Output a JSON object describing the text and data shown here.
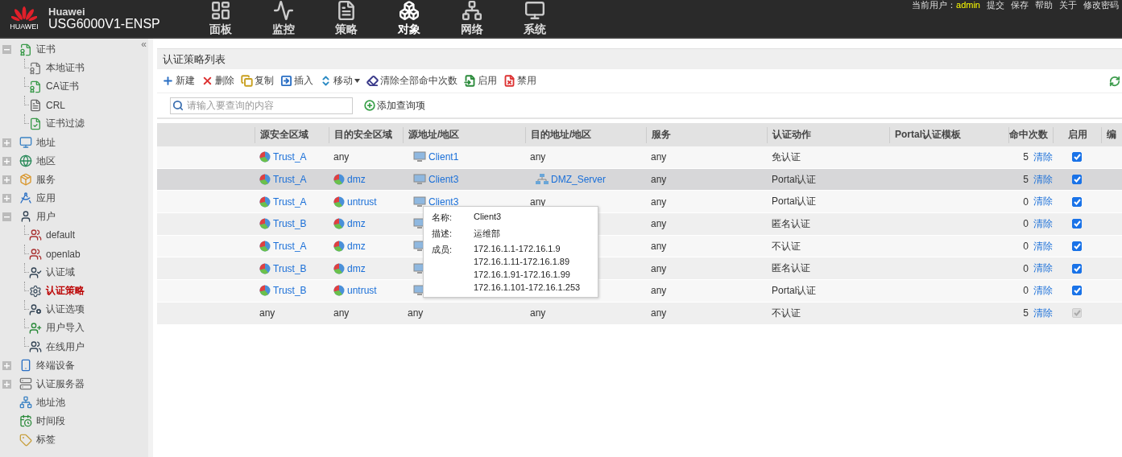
{
  "header": {
    "logo_text": "HUAWEI",
    "brand": "Huawei",
    "product": "USG6000V1-ENSP",
    "nav": [
      {
        "label": "面板",
        "selected": false
      },
      {
        "label": "监控",
        "selected": false
      },
      {
        "label": "策略",
        "selected": false
      },
      {
        "label": "对象",
        "selected": true
      },
      {
        "label": "网络",
        "selected": false
      },
      {
        "label": "系统",
        "selected": false
      }
    ],
    "user_label": "当前用户：",
    "user_name": "admin",
    "links": [
      "提交",
      "保存",
      "帮助",
      "关于",
      "修改密码"
    ]
  },
  "sidebar": {
    "collapse": "«",
    "items": [
      {
        "label": "证书",
        "expanded": true,
        "selected": false,
        "children": [
          {
            "label": "本地证书",
            "selected": false
          },
          {
            "label": "CA证书",
            "selected": false
          },
          {
            "label": "CRL",
            "selected": false
          },
          {
            "label": "证书过滤",
            "selected": false
          }
        ]
      },
      {
        "label": "地址",
        "expanded": false,
        "selected": false
      },
      {
        "label": "地区",
        "expanded": false,
        "selected": false
      },
      {
        "label": "服务",
        "expanded": false,
        "selected": false
      },
      {
        "label": "应用",
        "expanded": false,
        "selected": false
      },
      {
        "label": "用户",
        "expanded": true,
        "selected": false,
        "children": [
          {
            "label": "default",
            "selected": false
          },
          {
            "label": "openlab",
            "selected": false
          },
          {
            "label": "认证域",
            "selected": false
          },
          {
            "label": "认证策略",
            "selected": true
          },
          {
            "label": "认证选项",
            "selected": false
          },
          {
            "label": "用户导入",
            "selected": false
          },
          {
            "label": "在线用户",
            "selected": false
          }
        ]
      },
      {
        "label": "终端设备",
        "expanded": false,
        "selected": false
      },
      {
        "label": "认证服务器",
        "expanded": false,
        "selected": false
      },
      {
        "label": "地址池",
        "selected": false
      },
      {
        "label": "时间段",
        "selected": false
      },
      {
        "label": "标签",
        "selected": false
      }
    ]
  },
  "panel": {
    "title": "认证策略列表",
    "toolbar": [
      {
        "label": "新建",
        "has_menu": false
      },
      {
        "label": "删除",
        "has_menu": false
      },
      {
        "label": "复制",
        "has_menu": false
      },
      {
        "label": "插入",
        "has_menu": false
      },
      {
        "label": "移动",
        "has_menu": true
      },
      {
        "label": "清除全部命中次数",
        "has_menu": false
      },
      {
        "label": "启用",
        "has_menu": false
      },
      {
        "label": "禁用",
        "has_menu": false
      }
    ],
    "search": {
      "placeholder": "请输入要查询的内容"
    },
    "add_query": "添加查询项",
    "table": {
      "columns": [
        "源安全区域",
        "目的安全区域",
        "源地址/地区",
        "目的地址/地区",
        "服务",
        "认证动作",
        "Portal认证模板",
        "命中次数",
        "启用",
        "编"
      ],
      "rows": [
        {
          "selected": false,
          "src_zone": {
            "kind": "zone",
            "text": "Trust_A"
          },
          "dst_zone": {
            "kind": "plain",
            "text": "any"
          },
          "src_addr": {
            "kind": "address",
            "text": "Client1"
          },
          "dst_addr": {
            "kind": "plain",
            "text": "any"
          },
          "service": "any",
          "action": "免认证",
          "hits": "5",
          "clear": "清除",
          "checked": true,
          "disabled": false
        },
        {
          "selected": true,
          "src_zone": {
            "kind": "zone",
            "text": "Trust_A"
          },
          "dst_zone": {
            "kind": "zone",
            "text": "dmz"
          },
          "src_addr": {
            "kind": "address",
            "text": "Client3"
          },
          "dst_addr": {
            "kind": "server",
            "text": "DMZ_Server"
          },
          "service": "any",
          "action": "Portal认证",
          "hits": "5",
          "clear": "清除",
          "checked": true,
          "disabled": false
        },
        {
          "selected": false,
          "src_zone": {
            "kind": "zone",
            "text": "Trust_A"
          },
          "dst_zone": {
            "kind": "zone",
            "text": "untrust"
          },
          "src_addr": {
            "kind": "address",
            "text": "Client3"
          },
          "dst_addr": {
            "kind": "plain",
            "text": "any"
          },
          "service": "any",
          "action": "Portal认证",
          "hits": "0",
          "clear": "清除",
          "checked": true,
          "disabled": false
        },
        {
          "selected": false,
          "src_zone": {
            "kind": "zone",
            "text": "Trust_B"
          },
          "dst_zone": {
            "kind": "zone",
            "text": "dmz"
          },
          "src_addr": {
            "kind": "address"
          },
          "service": "any",
          "action": "匿名认证",
          "hits": "0",
          "clear": "清除",
          "checked": true,
          "disabled": false
        },
        {
          "selected": false,
          "src_zone": {
            "kind": "zone",
            "text": "Trust_A"
          },
          "dst_zone": {
            "kind": "zone",
            "text": "dmz"
          },
          "src_addr": {
            "kind": "address"
          },
          "service": "any",
          "action": "不认证",
          "hits": "0",
          "clear": "清除",
          "checked": true,
          "disabled": false
        },
        {
          "selected": false,
          "src_zone": {
            "kind": "zone",
            "text": "Trust_B"
          },
          "dst_zone": {
            "kind": "zone",
            "text": "dmz"
          },
          "src_addr": {
            "kind": "address"
          },
          "service": "any",
          "action": "匿名认证",
          "hits": "0",
          "clear": "清除",
          "checked": true,
          "disabled": false
        },
        {
          "selected": false,
          "src_zone": {
            "kind": "zone",
            "text": "Trust_B"
          },
          "dst_zone": {
            "kind": "zone",
            "text": "untrust"
          },
          "src_addr": {
            "kind": "address"
          },
          "service": "any",
          "action": "Portal认证",
          "hits": "0",
          "clear": "清除",
          "checked": true,
          "disabled": false
        },
        {
          "selected": false,
          "src_zone": {
            "kind": "plain",
            "text": "any"
          },
          "dst_zone": {
            "kind": "plain",
            "text": "any"
          },
          "src_addr": {
            "kind": "plain",
            "text": "any"
          },
          "dst_addr": {
            "kind": "plain",
            "text": "any"
          },
          "service": "any",
          "action": "不认证",
          "hits": "5",
          "clear": "清除",
          "checked": true,
          "disabled": true
        }
      ]
    },
    "tooltip": {
      "fields": [
        {
          "label": "名称:",
          "values": [
            "Client3"
          ]
        },
        {
          "label": "描述:",
          "values": [
            "运维部"
          ]
        },
        {
          "label": "成员:",
          "values": [
            "172.16.1.1-172.16.1.9",
            "172.16.1.11-172.16.1.89",
            "172.16.1.91-172.16.1.99",
            "172.16.1.101-172.16.1.253"
          ]
        }
      ]
    }
  }
}
